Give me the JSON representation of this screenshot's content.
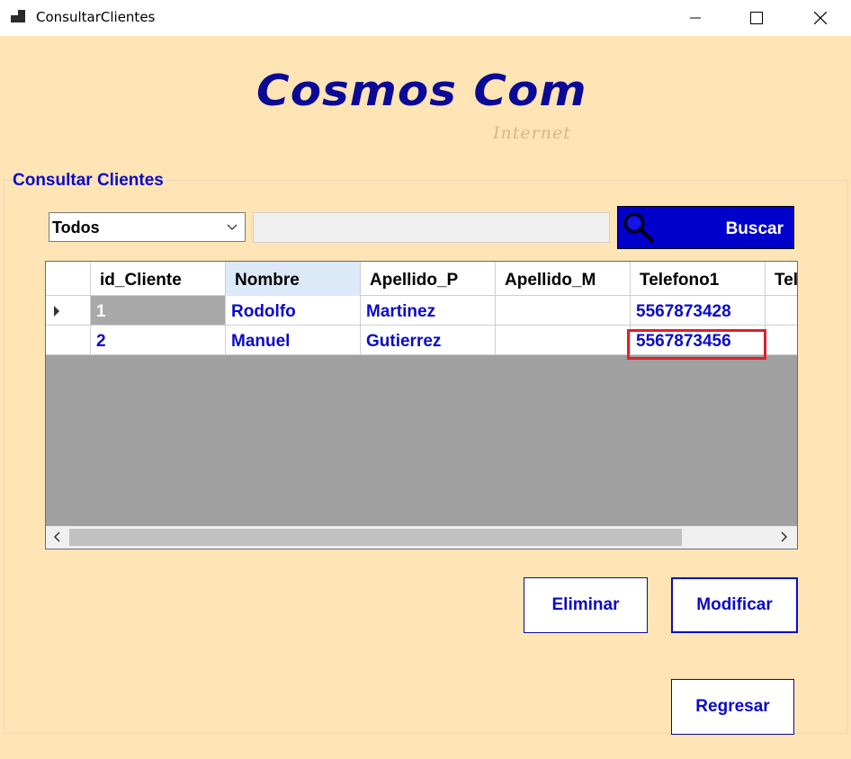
{
  "window": {
    "title": "ConsultarClientes",
    "min_icon": "minimize-icon",
    "max_icon": "maximize-icon",
    "close_icon": "close-icon"
  },
  "logo": {
    "main": "Cosmos Com",
    "sub": "Internet"
  },
  "group": {
    "title": "Consultar Clientes"
  },
  "filter": {
    "selected": "Todos",
    "search_value": "",
    "search_button_label": "Buscar"
  },
  "grid": {
    "columns": [
      "id_Cliente",
      "Nombre",
      "Apellido_P",
      "Apellido_M",
      "Telefono1",
      "Tel"
    ],
    "rows": [
      {
        "id_Cliente": "1",
        "Nombre": "Rodolfo",
        "Apellido_P": "Martinez",
        "Apellido_M": "",
        "Telefono1": "5567873428"
      },
      {
        "id_Cliente": "2",
        "Nombre": "Manuel",
        "Apellido_P": "Gutierrez",
        "Apellido_M": "",
        "Telefono1": "5567873456"
      }
    ]
  },
  "buttons": {
    "eliminar": "Eliminar",
    "modificar": "Modificar",
    "regresar": "Regresar"
  },
  "colors": {
    "background": "#FFE4B5",
    "accent_blue": "#0000CC",
    "text_blue": "#0A0AC8",
    "highlight_red": "#E0202A"
  }
}
